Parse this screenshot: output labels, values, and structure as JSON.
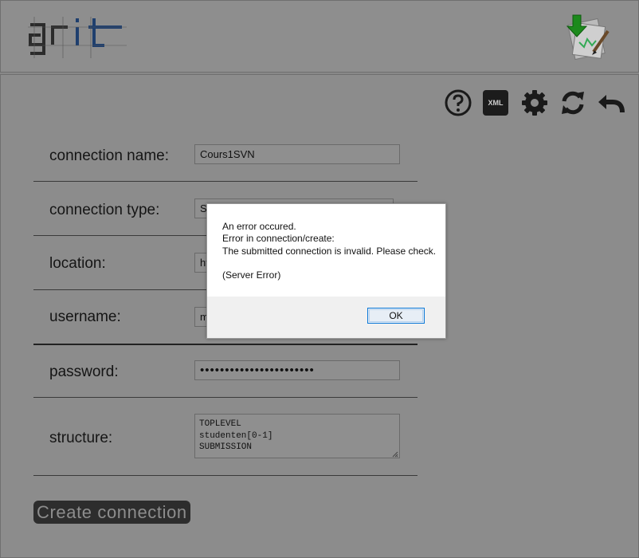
{
  "header": {
    "logo_text": "grit",
    "colors": {
      "logo_dark": "#2b2b2b",
      "logo_accent": "#1f3f6e"
    }
  },
  "toolbar": {
    "icons": [
      "help-icon",
      "xml-icon",
      "settings-icon",
      "sync-icon",
      "back-icon"
    ],
    "xml_label": "XML"
  },
  "form": {
    "connection_name": {
      "label": "connection name:",
      "value": "Cours1SVN"
    },
    "connection_type": {
      "label": "connection type:",
      "value": "S"
    },
    "location": {
      "label": "location:",
      "value": "ht"
    },
    "username": {
      "label": "username:",
      "value": "m"
    },
    "password": {
      "label": "password:",
      "value": "•••••••••••••••••••••••"
    },
    "structure": {
      "label": "structure:",
      "value": "TOPLEVEL\nstudenten[0-1]\nSUBMISSION"
    }
  },
  "create_button": {
    "label": "Create connection"
  },
  "dialog": {
    "line1": "An error occured.",
    "line2": "Error in connection/create:",
    "line3": "The submitted connection is invalid. Please check.",
    "line4": "(Server Error)",
    "ok_label": "OK"
  }
}
